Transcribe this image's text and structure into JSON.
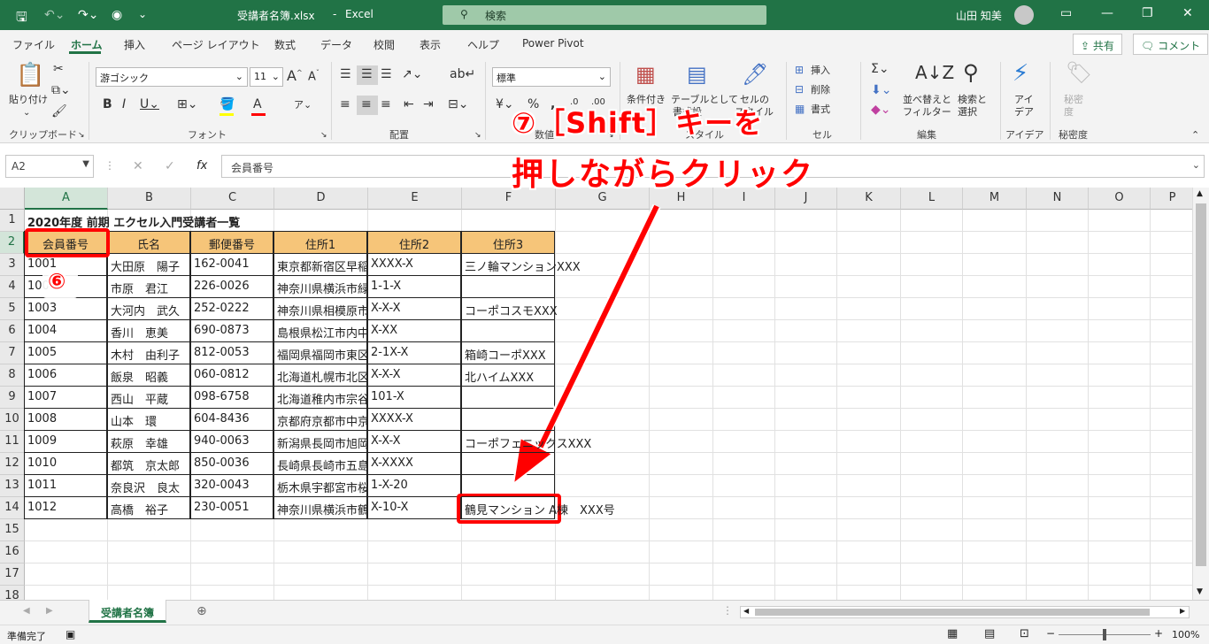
{
  "titlebar": {
    "filename": "受講者名簿.xlsx",
    "app": "Excel",
    "separator": "-",
    "search_placeholder": "検索",
    "user": "山田 知美"
  },
  "menu": [
    "ファイル",
    "ホーム",
    "挿入",
    "ページ レイアウト",
    "数式",
    "データ",
    "校閲",
    "表示",
    "ヘルプ",
    "Power Pivot"
  ],
  "share": {
    "share_label": "共有",
    "comment_label": "コメント"
  },
  "ribbon": {
    "paste_label": "貼り付け",
    "font_name": "游ゴシック",
    "font_size": "11",
    "number_format": "標準",
    "cond_format": "条件付き",
    "table_format_1": "テーブルとして",
    "table_format_2": "書式設",
    "cell_style_1": "セルの",
    "cell_style_2": "スタイル",
    "insert": "挿入",
    "delete": "削除",
    "format": "書式",
    "sort_1": "並べ替えと",
    "sort_2": "フィルター",
    "find_1": "検索と",
    "find_2": "選択",
    "idea_1": "アイ",
    "idea_2": "デア",
    "secret_1": "秘密",
    "secret_2": "度",
    "groups": {
      "clipboard": "クリップボード",
      "font": "フォント",
      "alignment": "配置",
      "number": "数値",
      "style": "スタイル",
      "cells": "セル",
      "editing": "編集",
      "ideas": "アイデア",
      "sensitivity": "秘密度"
    }
  },
  "formula_bar": {
    "name_box": "A2",
    "formula": "会員番号"
  },
  "columns": [
    "A",
    "B",
    "C",
    "D",
    "E",
    "F",
    "G",
    "H",
    "I",
    "J",
    "K",
    "L",
    "M",
    "N",
    "O",
    "P"
  ],
  "rows": [
    "1",
    "2",
    "3",
    "4",
    "5",
    "6",
    "7",
    "8",
    "9",
    "10",
    "11",
    "12",
    "13",
    "14",
    "15",
    "16",
    "17",
    "18"
  ],
  "sheet": {
    "title": "2020年度 前期 エクセル入門受講者一覧",
    "headers": [
      "会員番号",
      "氏名",
      "郵便番号",
      "住所1",
      "住所2",
      "住所3"
    ],
    "data": [
      [
        "1001",
        "大田原　陽子",
        "162-0041",
        "東京都新宿区早稲田",
        "XXXX-X",
        "三ノ輪マンションXXX"
      ],
      [
        "1002",
        "市原　君江",
        "226-0026",
        "神奈川県横浜市緑区",
        "1-1-X",
        ""
      ],
      [
        "1003",
        "大河内　武久",
        "252-0222",
        "神奈川県相模原市",
        "X-X-X",
        "コーポコスモXXX"
      ],
      [
        "1004",
        "香川　恵美",
        "690-0873",
        "島根県松江市内中原",
        "X-XX",
        ""
      ],
      [
        "1005",
        "木村　由利子",
        "812-0053",
        "福岡県福岡市東区",
        "2-1X-X",
        "箱崎コーポXXX"
      ],
      [
        "1006",
        "飯泉　昭義",
        "060-0812",
        "北海道札幌市北区",
        "X-X-X",
        "北ハイムXXX"
      ],
      [
        "1007",
        "西山　平蔵",
        "098-6758",
        "北海道稚内市宗谷",
        "101-X",
        ""
      ],
      [
        "1008",
        "山本　環",
        "604-8436",
        "京都府京都市中京区",
        "XXXX-X",
        ""
      ],
      [
        "1009",
        "萩原　幸雄",
        "940-0063",
        "新潟県長岡市旭岡",
        "X-X-X",
        "コーポフェニックスXXX"
      ],
      [
        "1010",
        "都筑　京太郎",
        "850-0036",
        "長崎県長崎市五島町",
        "X-XXXX",
        ""
      ],
      [
        "1011",
        "奈良沢　良太",
        "320-0043",
        "栃木県宇都宮市桜",
        "1-X-20",
        ""
      ],
      [
        "1012",
        "高橋　裕子",
        "230-0051",
        "神奈川県横浜市鶴見区",
        "X-10-X",
        "鶴見マンション A棟　XXX号"
      ]
    ]
  },
  "sheet_tab": "受講者名簿",
  "status": {
    "ready": "準備完了",
    "zoom": "100%"
  },
  "annotations": {
    "step6": "⑥",
    "step7_line1": "⑦［Shift］キーを",
    "step7_line2": "押しながらクリック"
  }
}
